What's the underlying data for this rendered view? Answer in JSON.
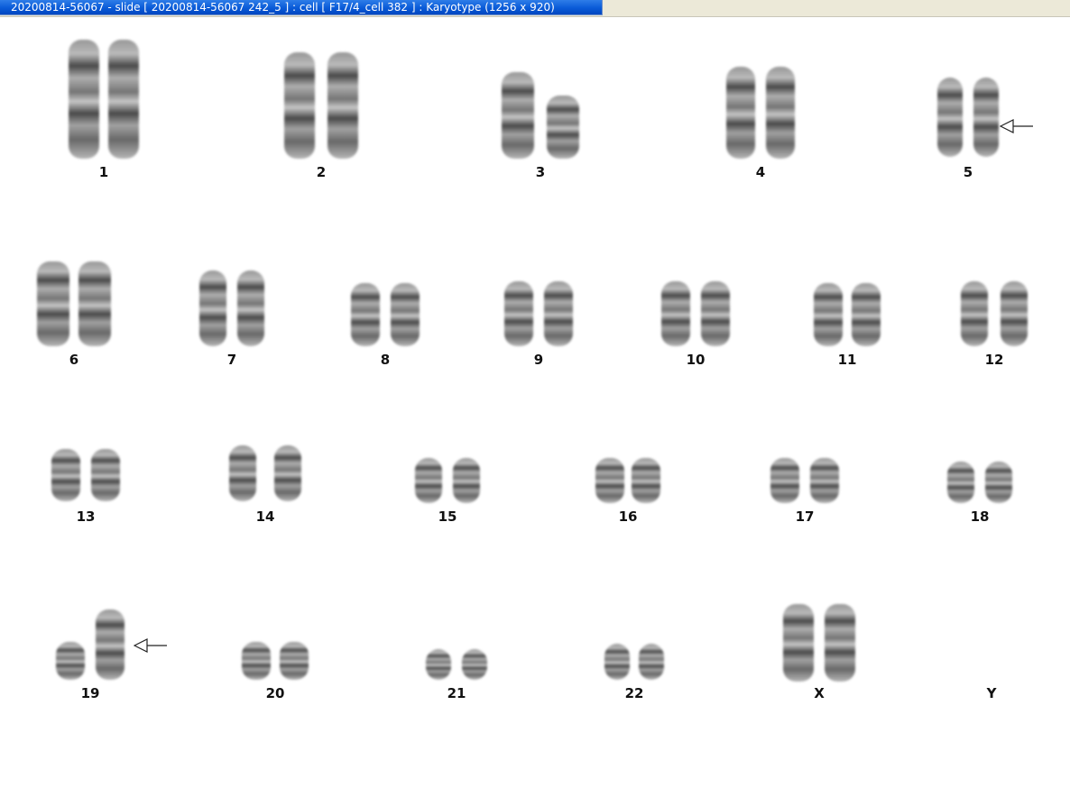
{
  "window": {
    "title": "20200814-56067 - slide [ 20200814-56067 242_5 ] : cell [ F17/4_cell 382 ] : Karyotype  (1256 x 920)"
  },
  "karyotype": {
    "labels": [
      "1",
      "2",
      "3",
      "4",
      "5",
      "6",
      "7",
      "8",
      "9",
      "10",
      "11",
      "12",
      "13",
      "14",
      "15",
      "16",
      "17",
      "18",
      "19",
      "20",
      "21",
      "22",
      "X",
      "Y"
    ],
    "arrows": [
      "5",
      "19"
    ]
  },
  "colors": {
    "title_bar": "#0a5bd8",
    "title_text": "#ffffff",
    "background": "#ffffff",
    "chromosome": "#8f8f8f",
    "band": "#3a3a3a"
  }
}
